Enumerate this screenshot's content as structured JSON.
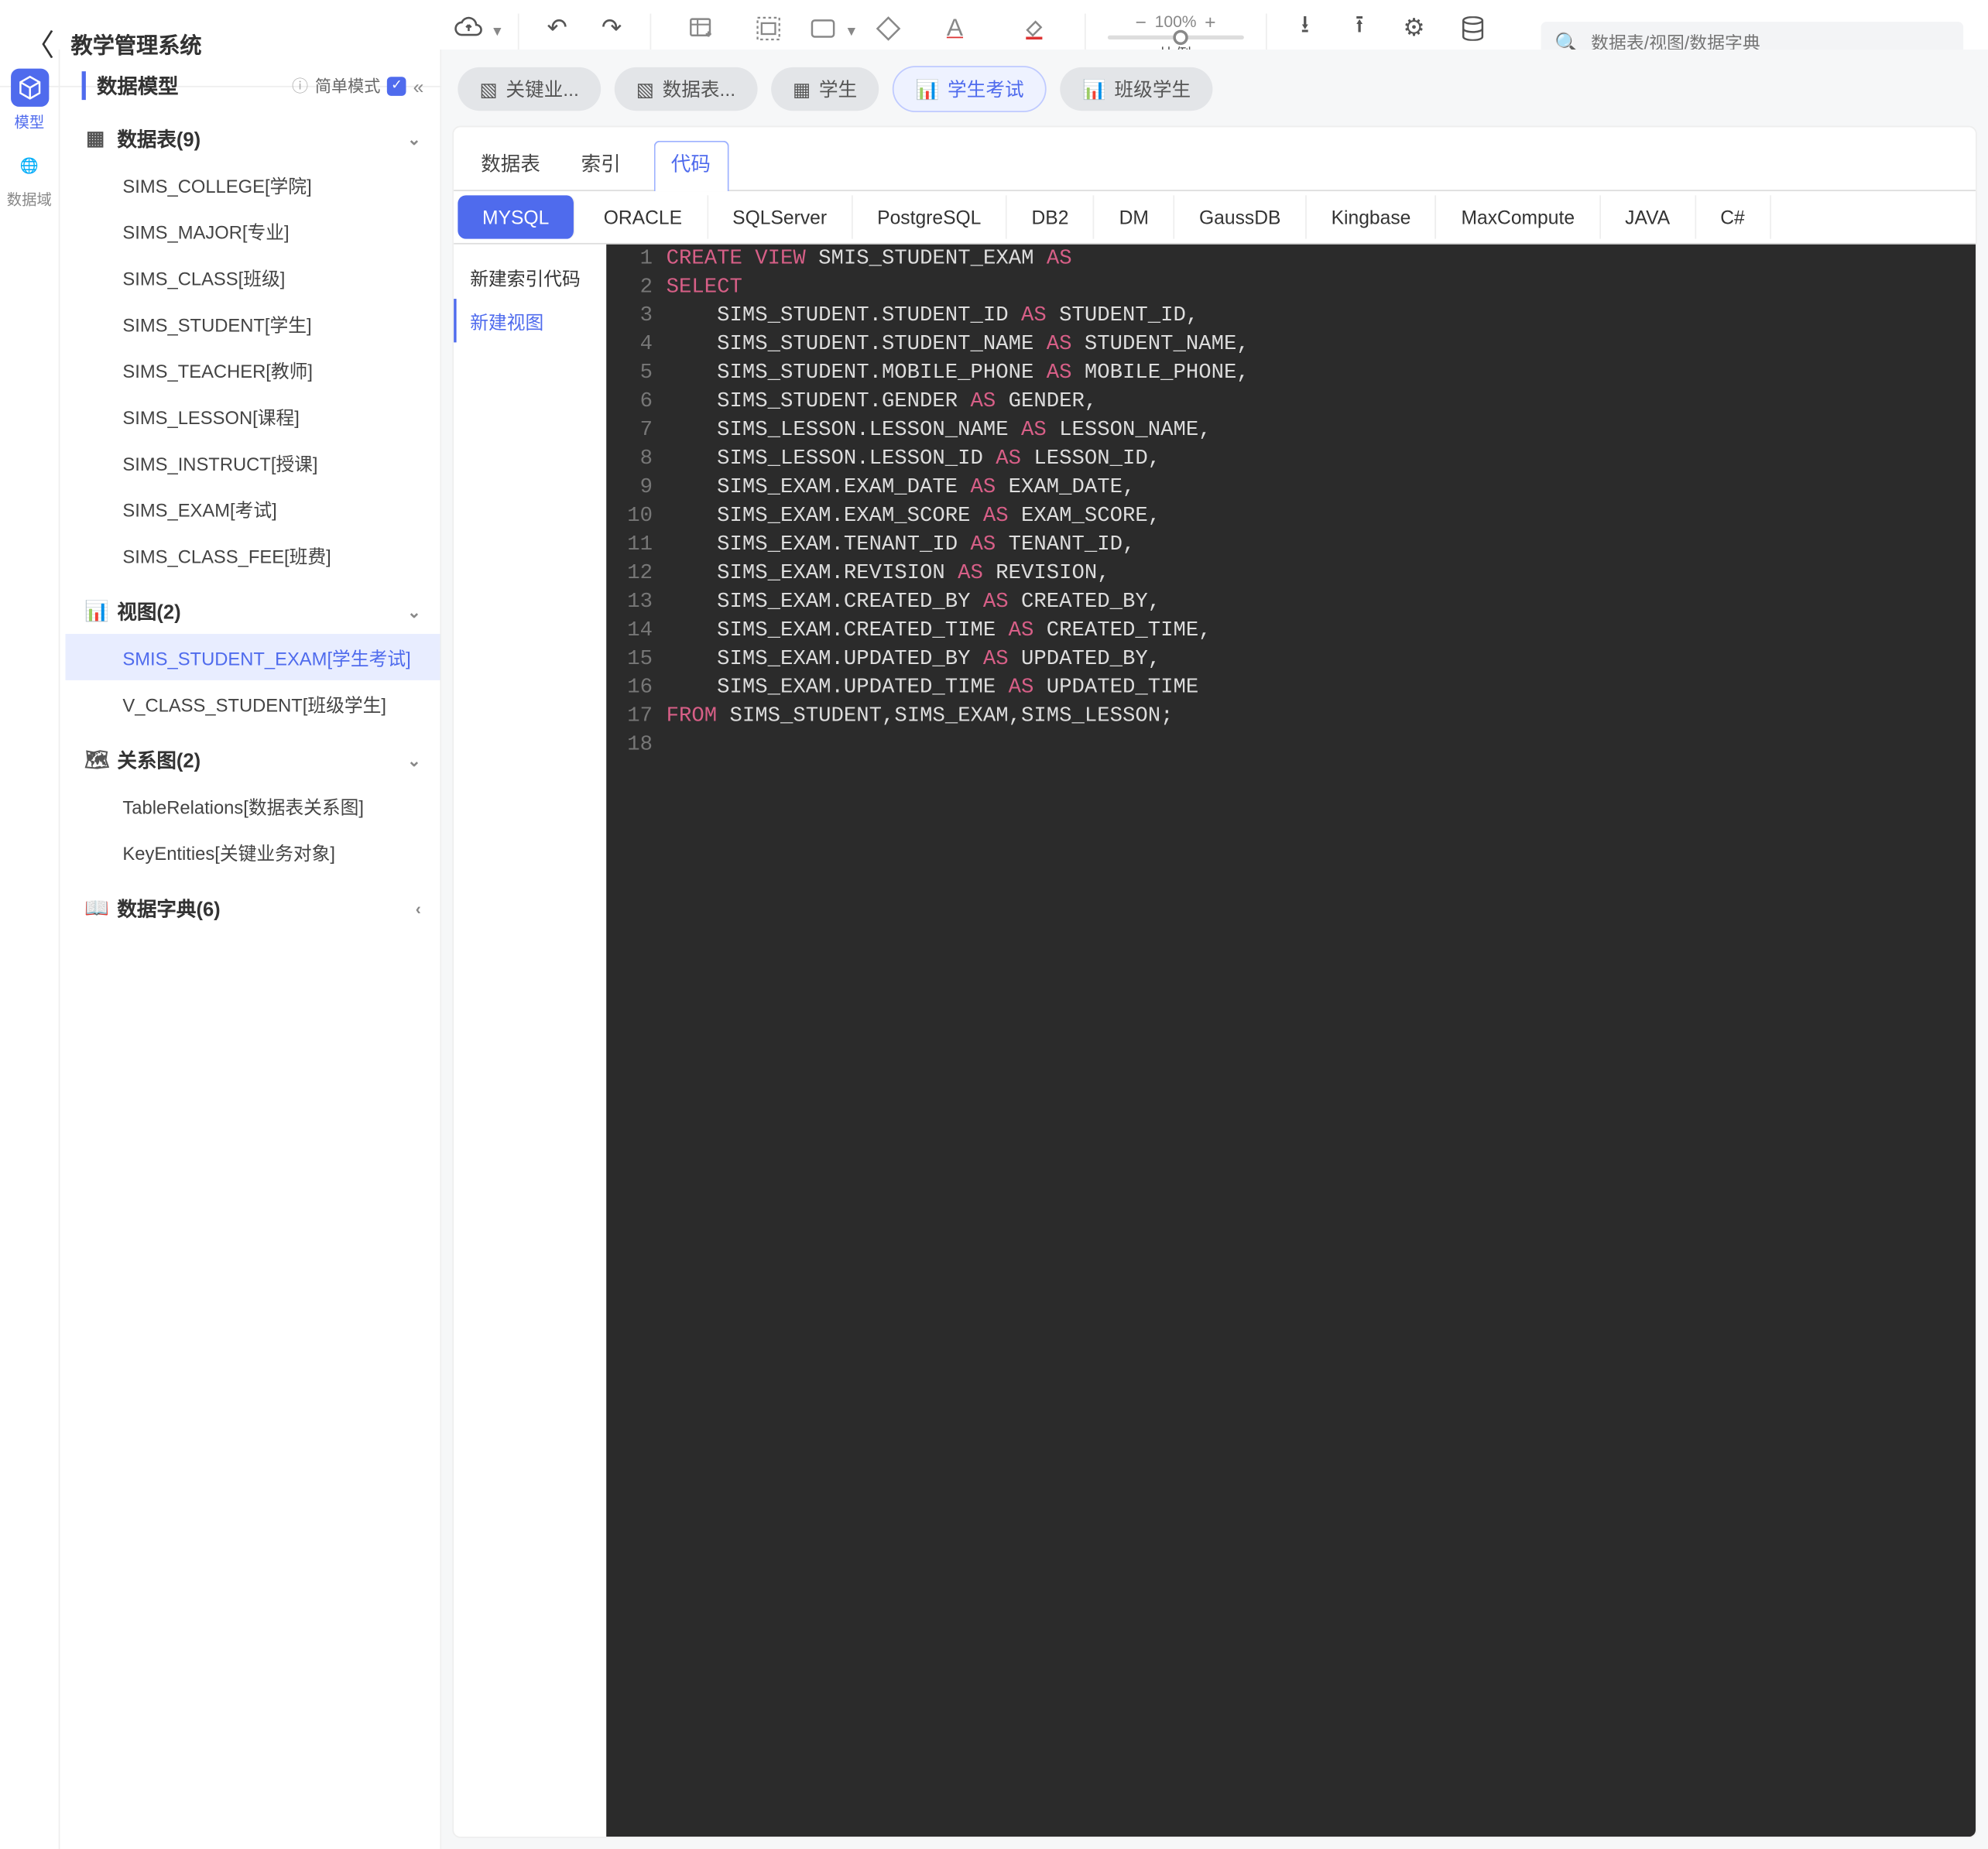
{
  "header": {
    "title": "教学管理系统",
    "buttons": {
      "save": "保存",
      "undo": "撤销",
      "redo": "重做",
      "newEmptyTable": "新建空表",
      "group": "分组",
      "rect": "矩形",
      "diamond": "菱形",
      "fontColor": "字体颜色",
      "fillColor": "填充颜色",
      "import": "导入",
      "export": "导出",
      "settings": "设置",
      "database": "数据库",
      "zoomLabel": "比例",
      "zoomPct": "100%"
    },
    "searchPlaceholder": "数据表/视图/数据字典"
  },
  "rail": [
    {
      "label": "模型",
      "active": true
    },
    {
      "label": "数据域",
      "active": false
    }
  ],
  "sidebar": {
    "title": "数据模型",
    "modeLabel": "简单模式",
    "groups": [
      {
        "key": "tables",
        "label": "数据表(9)",
        "expanded": true,
        "items": [
          "SIMS_COLLEGE[学院]",
          "SIMS_MAJOR[专业]",
          "SIMS_CLASS[班级]",
          "SIMS_STUDENT[学生]",
          "SIMS_TEACHER[教师]",
          "SIMS_LESSON[课程]",
          "SIMS_INSTRUCT[授课]",
          "SIMS_EXAM[考试]",
          "SIMS_CLASS_FEE[班费]"
        ]
      },
      {
        "key": "views",
        "label": "视图(2)",
        "expanded": true,
        "selected": 0,
        "items": [
          "SMIS_STUDENT_EXAM[学生考试]",
          "V_CLASS_STUDENT[班级学生]"
        ]
      },
      {
        "key": "diagrams",
        "label": "关系图(2)",
        "expanded": true,
        "items": [
          "TableRelations[数据表关系图]",
          "KeyEntities[关键业务对象]"
        ]
      },
      {
        "key": "dicts",
        "label": "数据字典(6)",
        "expanded": false,
        "items": []
      }
    ]
  },
  "tabs": [
    {
      "label": "关键业...",
      "icon": "diagram"
    },
    {
      "label": "数据表...",
      "icon": "diagram"
    },
    {
      "label": "学生",
      "icon": "table"
    },
    {
      "label": "学生考试",
      "icon": "view",
      "active": true
    },
    {
      "label": "班级学生",
      "icon": "view"
    }
  ],
  "subTabs": [
    {
      "label": "数据表"
    },
    {
      "label": "索引"
    },
    {
      "label": "代码",
      "active": true
    }
  ],
  "dbTabs": [
    {
      "label": "MYSQL",
      "active": true
    },
    {
      "label": "ORACLE"
    },
    {
      "label": "SQLServer"
    },
    {
      "label": "PostgreSQL"
    },
    {
      "label": "DB2"
    },
    {
      "label": "DM"
    },
    {
      "label": "GaussDB"
    },
    {
      "label": "Kingbase"
    },
    {
      "label": "MaxCompute"
    },
    {
      "label": "JAVA"
    },
    {
      "label": "C#"
    }
  ],
  "codeSide": [
    {
      "label": "新建索引代码"
    },
    {
      "label": "新建视图",
      "active": true
    }
  ],
  "sql": [
    [
      {
        "t": "CREATE",
        "k": 1
      },
      {
        "t": " "
      },
      {
        "t": "VIEW",
        "k": 1
      },
      {
        "t": " SMIS_STUDENT_EXAM "
      },
      {
        "t": "AS",
        "k": 1
      }
    ],
    [
      {
        "t": "SELECT",
        "k": 1
      }
    ],
    [
      {
        "t": "    SIMS_STUDENT.STUDENT_ID "
      },
      {
        "t": "AS",
        "k": 1
      },
      {
        "t": " STUDENT_ID,"
      }
    ],
    [
      {
        "t": "    SIMS_STUDENT.STUDENT_NAME "
      },
      {
        "t": "AS",
        "k": 1
      },
      {
        "t": " STUDENT_NAME,"
      }
    ],
    [
      {
        "t": "    SIMS_STUDENT.MOBILE_PHONE "
      },
      {
        "t": "AS",
        "k": 1
      },
      {
        "t": " MOBILE_PHONE,"
      }
    ],
    [
      {
        "t": "    SIMS_STUDENT.GENDER "
      },
      {
        "t": "AS",
        "k": 1
      },
      {
        "t": " GENDER,"
      }
    ],
    [
      {
        "t": "    SIMS_LESSON.LESSON_NAME "
      },
      {
        "t": "AS",
        "k": 1
      },
      {
        "t": " LESSON_NAME,"
      }
    ],
    [
      {
        "t": "    SIMS_LESSON.LESSON_ID "
      },
      {
        "t": "AS",
        "k": 1
      },
      {
        "t": " LESSON_ID,"
      }
    ],
    [
      {
        "t": "    SIMS_EXAM.EXAM_DATE "
      },
      {
        "t": "AS",
        "k": 1
      },
      {
        "t": " EXAM_DATE,"
      }
    ],
    [
      {
        "t": "    SIMS_EXAM.EXAM_SCORE "
      },
      {
        "t": "AS",
        "k": 1
      },
      {
        "t": " EXAM_SCORE,"
      }
    ],
    [
      {
        "t": "    SIMS_EXAM.TENANT_ID "
      },
      {
        "t": "AS",
        "k": 1
      },
      {
        "t": " TENANT_ID,"
      }
    ],
    [
      {
        "t": "    SIMS_EXAM.REVISION "
      },
      {
        "t": "AS",
        "k": 1
      },
      {
        "t": " REVISION,"
      }
    ],
    [
      {
        "t": "    SIMS_EXAM.CREATED_BY "
      },
      {
        "t": "AS",
        "k": 1
      },
      {
        "t": " CREATED_BY,"
      }
    ],
    [
      {
        "t": "    SIMS_EXAM.CREATED_TIME "
      },
      {
        "t": "AS",
        "k": 1
      },
      {
        "t": " CREATED_TIME,"
      }
    ],
    [
      {
        "t": "    SIMS_EXAM.UPDATED_BY "
      },
      {
        "t": "AS",
        "k": 1
      },
      {
        "t": " UPDATED_BY,"
      }
    ],
    [
      {
        "t": "    SIMS_EXAM.UPDATED_TIME "
      },
      {
        "t": "AS",
        "k": 1
      },
      {
        "t": " UPDATED_TIME"
      }
    ],
    [
      {
        "t": "FROM",
        "k": 1
      },
      {
        "t": " SIMS_STUDENT,SIMS_EXAM,SIMS_LESSON;"
      }
    ],
    [
      {
        "t": ""
      }
    ]
  ]
}
